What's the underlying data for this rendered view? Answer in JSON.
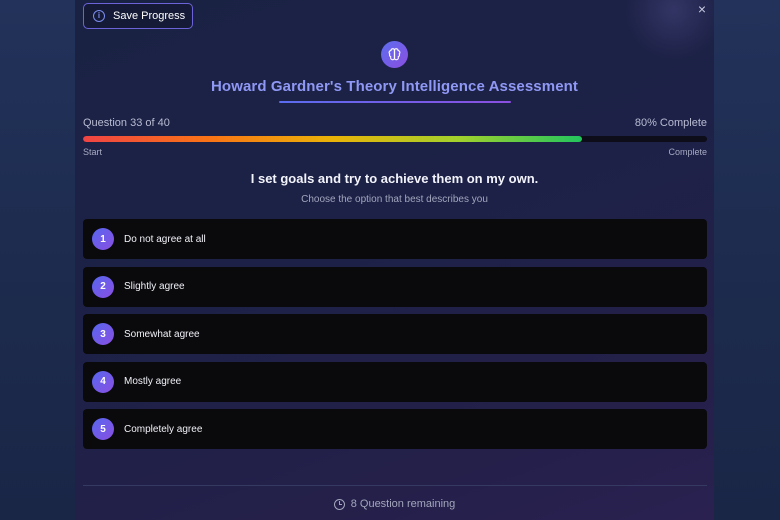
{
  "header": {
    "save_label": "Save Progress",
    "save_icon": "info-icon",
    "close_icon": "close-icon",
    "close_glyph": "×",
    "brain_icon": "brain-icon",
    "title": "Howard Gardner's Theory Intelligence Assessment"
  },
  "progress": {
    "question_label": "Question 33 of 40",
    "percent_label": "80% Complete",
    "fraction": 0.8,
    "start_label": "Start",
    "end_label": "Complete",
    "gradient_colors": [
      "#ef4444",
      "#f97316",
      "#eab308",
      "#a3d12c",
      "#22c55e"
    ]
  },
  "question": {
    "text": "I set goals and try to achieve them on my own.",
    "instruction": "Choose the option that best describes you"
  },
  "options": [
    {
      "num": "1",
      "label": "Do not agree at all"
    },
    {
      "num": "2",
      "label": "Slightly agree"
    },
    {
      "num": "3",
      "label": "Somewhat agree"
    },
    {
      "num": "4",
      "label": "Mostly agree"
    },
    {
      "num": "5",
      "label": "Completely agree"
    }
  ],
  "footer": {
    "clock_icon": "clock-icon",
    "remaining_label": "8 Question remaining"
  },
  "colors": {
    "accent": "#6c63d9",
    "title": "#8f98f5",
    "option_bg": "#0a0a0c"
  }
}
